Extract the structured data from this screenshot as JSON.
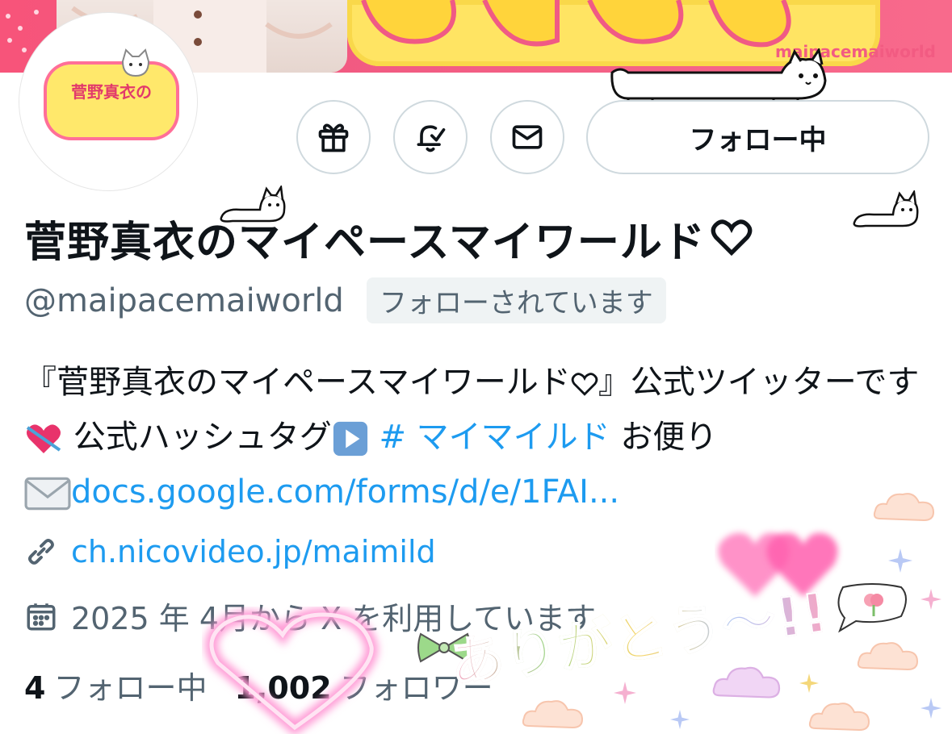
{
  "banner": {
    "world_text": "maipacemaiworld",
    "colors": {
      "pink": "#f25b82",
      "yellow": "#ffe463"
    }
  },
  "avatar": {
    "text": "菅野真衣の"
  },
  "actions": {
    "gift_icon": "gift-icon",
    "notify_icon": "bell-check-icon",
    "message_icon": "mail-icon",
    "follow_label": "フォロー中"
  },
  "profile": {
    "name": "菅野真衣のマイペースマイワールド",
    "handle": "@maipacemaiworld",
    "follows_you": "フォローされています",
    "bio_part1": "『菅野真衣のマイペースマイワールド",
    "bio_part2": "』公式ツイッターです",
    "bio_part3": " 公式ハッシュタグ",
    "hashtag": "# マイマイルド",
    "bio_part4": " お便り",
    "bio_link": "docs.google.com/forms/d/e/1FAI...",
    "website": "ch.nicovideo.jp/maimild",
    "joined": "2025 年 4月から X を利用しています"
  },
  "stats": {
    "following_count": "4",
    "following_label": "フォロー中",
    "followers_count": "1,002",
    "followers_label": "フォロワー"
  },
  "stickers": {
    "arigato": "ありがとう〜!!"
  }
}
